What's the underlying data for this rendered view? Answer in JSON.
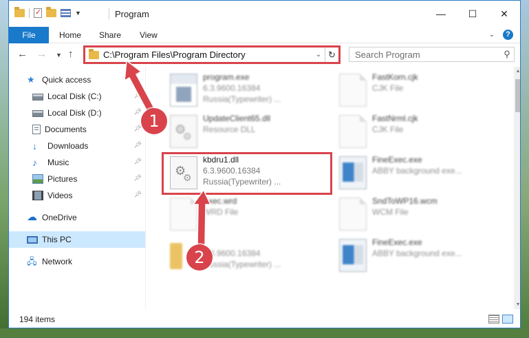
{
  "window": {
    "title": "Program",
    "controls": [
      "—",
      "☐",
      "✕"
    ]
  },
  "ribbon": {
    "tabs": [
      "File",
      "Home",
      "Share",
      "View"
    ],
    "expand_icon": "⌄",
    "help_label": "?"
  },
  "address_bar": {
    "path": "C:\\Program Files\\Program Directory"
  },
  "search": {
    "placeholder": "Search Program"
  },
  "sidebar": {
    "items": [
      {
        "label": "Quick access",
        "icon": "star-icon"
      },
      {
        "label": "Local Disk (C:)",
        "icon": "drive-icon",
        "pinned": true
      },
      {
        "label": "Local Disk (D:)",
        "icon": "drive-icon",
        "pinned": true
      },
      {
        "label": "Documents",
        "icon": "documents-icon",
        "pinned": true
      },
      {
        "label": "Downloads",
        "icon": "download-icon",
        "pinned": true
      },
      {
        "label": "Music",
        "icon": "music-icon",
        "pinned": true
      },
      {
        "label": "Pictures",
        "icon": "pictures-icon",
        "pinned": true
      },
      {
        "label": "Videos",
        "icon": "videos-icon",
        "pinned": true
      },
      {
        "label": "OneDrive",
        "icon": "cloud-icon"
      },
      {
        "label": "This PC",
        "icon": "computer-icon",
        "selected": true
      },
      {
        "label": "Network",
        "icon": "network-icon"
      }
    ]
  },
  "files": [
    {
      "name": "program.exe",
      "line1": "6.3.9600.16384",
      "line2": "Russia(Typewriter) ...",
      "icon": "app-icon"
    },
    {
      "name": "FastKorn.cjk",
      "line1": "CJK File",
      "line2": "",
      "icon": "document-icon"
    },
    {
      "name": "UpdateClient65.dll",
      "line1": "Resource DLL",
      "line2": "",
      "icon": "gear-file-icon"
    },
    {
      "name": "FastNrml.cjk",
      "line1": "CJK File",
      "line2": "",
      "icon": "document-icon"
    },
    {
      "name": "kbdru1.dll",
      "line1": "6.3.9600.16384",
      "line2": "Russia(Typewriter) ...",
      "icon": "gear-file-icon",
      "highlighted": true
    },
    {
      "name": "FineExec.exe",
      "line1": "ABBY background exe...",
      "line2": "",
      "icon": "exe-icon"
    },
    {
      "name": "Exec.wrd",
      "line1": "WRD File",
      "line2": "",
      "icon": "document-icon"
    },
    {
      "name": "SndToWP16.wcm",
      "line1": "WCM File",
      "line2": "",
      "icon": "document-icon"
    },
    {
      "name": "",
      "line1": "6.3.9600.16384",
      "line2": "Russia(Typewriter) ...",
      "icon": "folder-icon"
    },
    {
      "name": "FineExec.exe",
      "line1": "ABBY background exe...",
      "line2": "",
      "icon": "exe-icon"
    }
  ],
  "status": {
    "item_count": "194 items"
  },
  "callouts": [
    "1",
    "2"
  ],
  "colors": {
    "accent": "#1979ca",
    "highlight": "#d9434b",
    "selected_bg": "#cce8ff"
  }
}
